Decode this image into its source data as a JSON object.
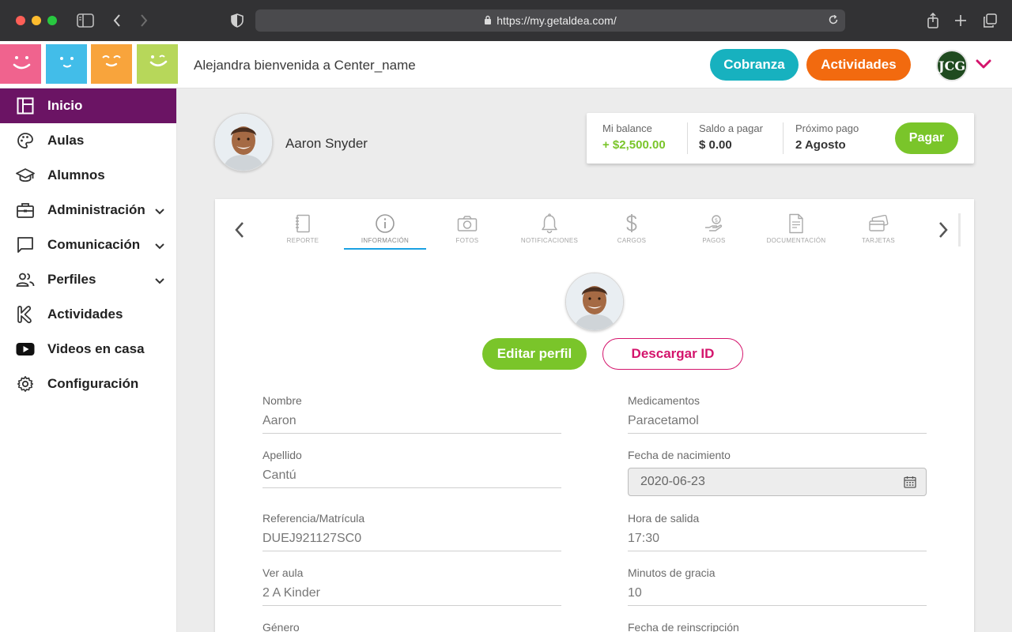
{
  "browser": {
    "url": "https://my.getaldea.com/"
  },
  "header": {
    "welcome": "Alejandra bienvenida a Center_name",
    "cobranza_label": "Cobranza",
    "actividades_label": "Actividades",
    "user_initials": "JCG"
  },
  "colors": {
    "brand_purple": "#6b1464",
    "cobranza": "#17b1bf",
    "actividades": "#f26a0f",
    "green": "#7ac52a",
    "pink": "#d4146c",
    "tab_active": "#1ba1e2",
    "logo_tiles": [
      "#f0638e",
      "#42bde9",
      "#f8a43c",
      "#b7d75a"
    ]
  },
  "sidebar": {
    "items": [
      {
        "label": "Inicio",
        "icon": "dashboard-icon"
      },
      {
        "label": "Aulas",
        "icon": "palette-icon"
      },
      {
        "label": "Alumnos",
        "icon": "graduation-cap-icon"
      },
      {
        "label": "Administración",
        "icon": "briefcase-icon"
      },
      {
        "label": "Comunicación",
        "icon": "chat-icon"
      },
      {
        "label": "Perfiles",
        "icon": "people-icon"
      },
      {
        "label": "Actividades",
        "icon": "k-logo-icon"
      },
      {
        "label": "Videos en casa",
        "icon": "youtube-icon"
      },
      {
        "label": "Configuración",
        "icon": "gear-icon"
      }
    ]
  },
  "student": {
    "name": "Aaron Snyder"
  },
  "balance": {
    "mi_balance_label": "Mi balance",
    "mi_balance_value": "+ $2,500.00",
    "saldo_label": "Saldo a pagar",
    "saldo_value": "$ 0.00",
    "proximo_label": "Próximo pago",
    "proximo_value": "2 Agosto",
    "pagar_label": "Pagar"
  },
  "tabs": [
    {
      "label": "REPORTE",
      "icon": "notebook-icon"
    },
    {
      "label": "INFORMACIÓN",
      "icon": "info-icon"
    },
    {
      "label": "FOTOS",
      "icon": "camera-icon"
    },
    {
      "label": "NOTIFICACIONES",
      "icon": "bell-icon"
    },
    {
      "label": "CARGOS",
      "icon": "dollar-icon"
    },
    {
      "label": "PAGOS",
      "icon": "hand-coin-icon"
    },
    {
      "label": "DOCUMENTACIÓN",
      "icon": "document-icon"
    },
    {
      "label": "TARJETAS",
      "icon": "cards-icon"
    }
  ],
  "profile_actions": {
    "editar": "Editar perfil",
    "descargar": "Descargar ID"
  },
  "fields": {
    "nombre": {
      "label": "Nombre",
      "value": "Aaron"
    },
    "apellido": {
      "label": "Apellido",
      "value": "Cantú"
    },
    "referencia": {
      "label": "Referencia/Matrícula",
      "value": "DUEJ921127SC0"
    },
    "aula": {
      "label": "Ver aula",
      "value": "2 A Kinder"
    },
    "genero": {
      "label": "Género"
    },
    "medicamentos": {
      "label": "Medicamentos",
      "value": "Paracetamol"
    },
    "nacimiento": {
      "label": "Fecha de nacimiento",
      "value": "2020-06-23"
    },
    "salida": {
      "label": "Hora de salida",
      "value": "17:30"
    },
    "gracia": {
      "label": "Minutos de gracia",
      "value": "10"
    },
    "reinscripcion": {
      "label": "Fecha de reinscripción"
    }
  }
}
